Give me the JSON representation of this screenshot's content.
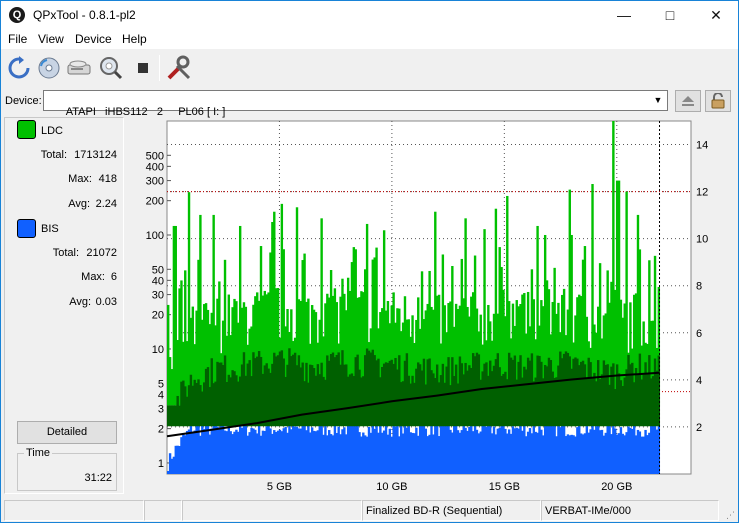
{
  "window": {
    "title": "QPxTool - 0.8.1-pl2",
    "app_icon_letter": "Q",
    "minimize_glyph": "—",
    "maximize_glyph": "□",
    "close_glyph": "✕"
  },
  "menu": [
    "File",
    "View",
    "Device",
    "Help"
  ],
  "toolbar": {
    "icons": [
      "refresh-icon",
      "disc-info-icon",
      "drive-icon",
      "scan-magnifier-icon",
      "stop-icon",
      "tools-icon"
    ]
  },
  "device": {
    "label": "Device:",
    "value": "ATAPI   iHBS112   2     PL06 [ I: ]",
    "dropdown_glyph": "▼",
    "eject_icon": "eject-icon",
    "lock_icon": "lock-icon"
  },
  "stats": {
    "ldc": {
      "name": "LDC",
      "color": "#00c000",
      "total_label": "Total:",
      "total": "1713124",
      "max_label": "Max:",
      "max": "418",
      "avg_label": "Avg:",
      "avg": "2.24"
    },
    "bis": {
      "name": "BIS",
      "color": "#1060ff",
      "total_label": "Total:",
      "total": "21072",
      "max_label": "Max:",
      "max": "6",
      "avg_label": "Avg:",
      "avg": "0.03"
    }
  },
  "detailed_button": "Detailed",
  "time": {
    "label": "Time",
    "value": "31:22"
  },
  "chart_data": {
    "type": "area",
    "left_axis": {
      "scale": "log",
      "ticks": [
        1,
        2,
        3,
        4,
        5,
        10,
        20,
        30,
        40,
        50,
        100,
        200,
        300,
        400,
        500
      ],
      "range": [
        0.8,
        1000
      ]
    },
    "right_axis": {
      "ticks": [
        2,
        4,
        6,
        8,
        10,
        12,
        14
      ],
      "range": [
        0,
        15
      ]
    },
    "x_axis": {
      "ticks": [
        "5 GB",
        "10 GB",
        "15 GB",
        "20 GB"
      ],
      "tick_values": [
        5,
        10,
        15,
        20
      ],
      "range": [
        0,
        23.3
      ],
      "data_end": 21.9
    },
    "threshold_lines_right": [
      3.5,
      12
    ],
    "series": [
      {
        "name": "LDC",
        "color": "#00c000",
        "dark_color": "#006000",
        "baseline": [
          5,
          12,
          15,
          16,
          17,
          18,
          16,
          17,
          18,
          17,
          16,
          15,
          15,
          16,
          17,
          16,
          16,
          17,
          15,
          14,
          16,
          15
        ],
        "spikes": [
          [
            0.3,
            120
          ],
          [
            0.9,
            95
          ],
          [
            1.4,
            150
          ],
          [
            2.0,
            60
          ],
          [
            3.2,
            120
          ],
          [
            4.1,
            80
          ],
          [
            4.6,
            130
          ],
          [
            4.7,
            160
          ],
          [
            5.1,
            75
          ],
          [
            5.7,
            70
          ],
          [
            6.8,
            140
          ],
          [
            8.8,
            50
          ],
          [
            9.6,
            110
          ],
          [
            11.3,
            48
          ],
          [
            11.9,
            160
          ],
          [
            13.2,
            140
          ],
          [
            14.1,
            45
          ],
          [
            14.6,
            170
          ],
          [
            15.1,
            220
          ],
          [
            16.2,
            50
          ],
          [
            16.4,
            120
          ],
          [
            16.8,
            40
          ],
          [
            17.9,
            100
          ],
          [
            18.5,
            80
          ],
          [
            18.9,
            280
          ],
          [
            19.8,
            400
          ],
          [
            20.0,
            300
          ],
          [
            20.4,
            240
          ],
          [
            20.9,
            60
          ],
          [
            21.4,
            60
          ],
          [
            21.8,
            35
          ]
        ]
      },
      {
        "name": "BIS",
        "color": "#1060ff",
        "baseline": [
          1,
          2,
          2,
          2,
          2,
          2,
          2,
          2,
          2,
          2,
          2,
          2,
          2,
          2,
          2,
          2,
          2,
          2,
          2,
          2,
          2,
          2
        ]
      },
      {
        "name": "Speed",
        "color": "#000000",
        "axis": "right",
        "x": [
          0,
          2,
          4,
          6,
          8,
          10,
          12,
          14,
          16,
          18,
          20,
          21.9
        ],
        "y": [
          1.6,
          1.9,
          2.2,
          2.5,
          2.8,
          3.1,
          3.3,
          3.6,
          3.8,
          4.0,
          4.2,
          4.3
        ]
      }
    ]
  },
  "status": {
    "cells": [
      "",
      "",
      "",
      "Finalized BD-R (Sequential)",
      "VERBAT-IMe/000"
    ]
  }
}
